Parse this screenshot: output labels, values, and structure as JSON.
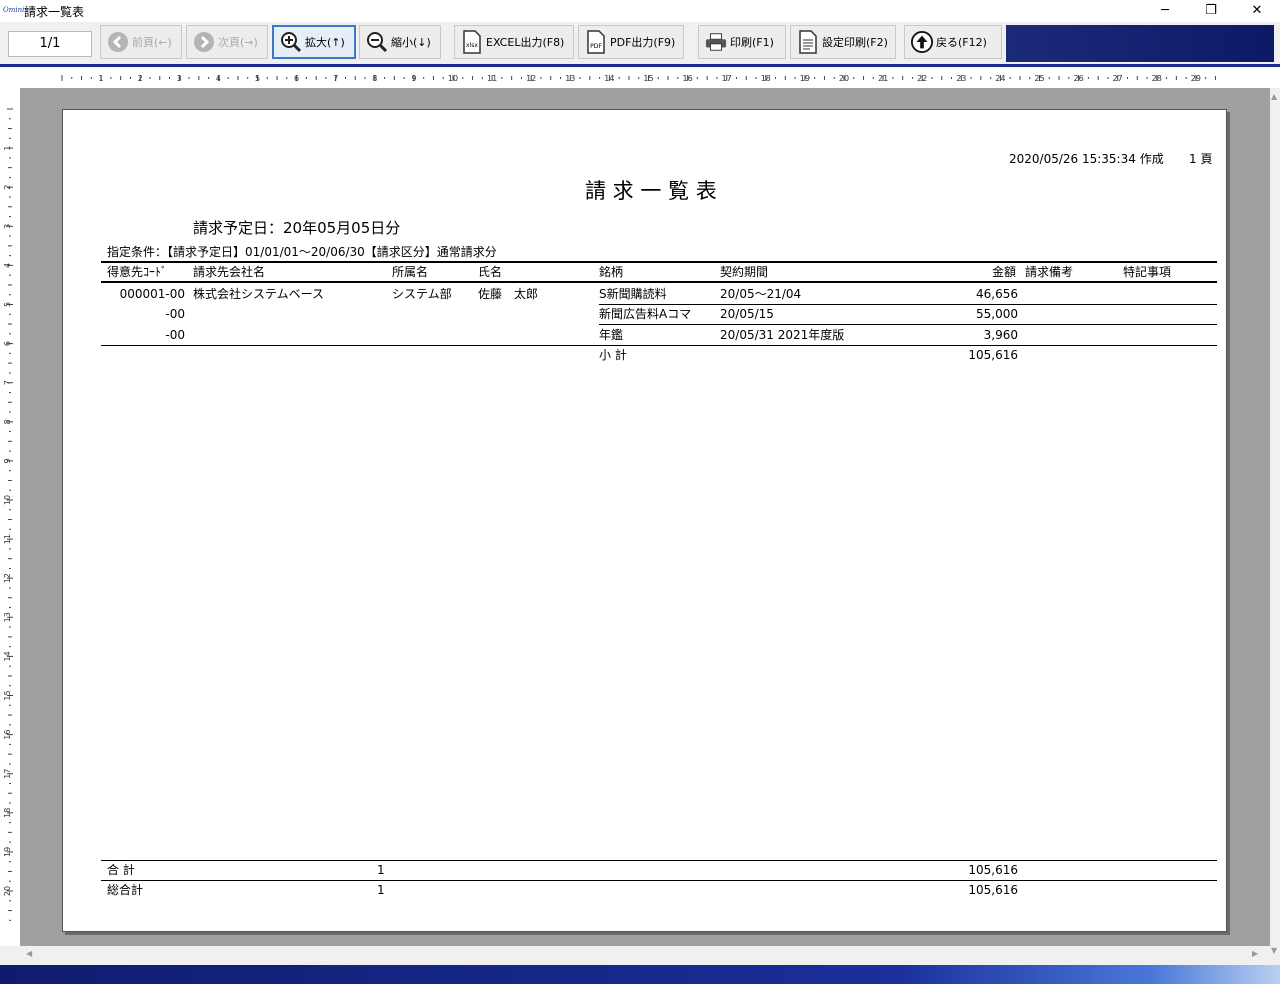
{
  "window": {
    "app_icon_text": "Ominis",
    "title": "請求一覧表",
    "minimize": "─",
    "restore": "❐",
    "close": "✕"
  },
  "toolbar": {
    "page_indicator": "1/1",
    "prev_label": "前頁(←)",
    "next_label": "次頁(→)",
    "zoom_in_label": "拡大(↑)",
    "zoom_out_label": "縮小(↓)",
    "excel_label": "EXCEL出力(F8)",
    "excel_icon_text": "xlsx",
    "pdf_label": "PDF出力(F9)",
    "pdf_icon_text": "PDF",
    "print_label": "印刷(F1)",
    "setting_print_label": "設定印刷(F2)",
    "back_label": "戻る(F12)"
  },
  "ruler": {
    "h_ticks": [
      "1",
      "2",
      "3",
      "4",
      "5",
      "6",
      "7",
      "8",
      "9",
      "10",
      "11",
      "12",
      "13",
      "14",
      "15",
      "16",
      "17",
      "18",
      "19",
      "20",
      "21",
      "22",
      "23",
      "24",
      "25",
      "26",
      "27",
      "28",
      "29"
    ],
    "v_ticks": [
      "1",
      "2",
      "3",
      "4",
      "5",
      "6",
      "7",
      "8",
      "9",
      "10",
      "11",
      "12",
      "13",
      "14",
      "15",
      "16",
      "17",
      "18",
      "19",
      "20"
    ]
  },
  "report": {
    "created": "2020/05/26 15:35:34 作成",
    "page_no": "1 頁",
    "title": "請 求 一 覧 表",
    "scheduled_date": "請求予定日：20年05月05日分",
    "condition": "指定条件：【請求予定日】01/01/01～20/06/30【請求区分】通常請求分",
    "headers": {
      "code": "得意先ｺｰﾄﾞ",
      "company": "請求先会社名",
      "dept": "所属名",
      "name": "氏名",
      "item": "銘柄",
      "period": "契約期間",
      "amount": "金額",
      "remark": "請求備考",
      "note": "特記事項"
    },
    "rows": [
      {
        "code": "000001-00",
        "company": "株式会社システムベース",
        "dept": "システム部",
        "name": "佐藤　太郎",
        "item": "S新聞購読料",
        "period": "20/05～21/04",
        "amount": "46,656"
      },
      {
        "code": "-00",
        "company": "",
        "dept": "",
        "name": "",
        "item": "新聞広告料Aコマ",
        "period": "20/05/15",
        "amount": "55,000"
      },
      {
        "code": "-00",
        "company": "",
        "dept": "",
        "name": "",
        "item": "年鑑",
        "period": "20/05/31 2021年度版",
        "amount": "3,960"
      }
    ],
    "subtotal": {
      "label": "小 計",
      "amount": "105,616"
    },
    "total": {
      "label": "合 計",
      "count": "1",
      "amount": "105,616"
    },
    "grand_total": {
      "label": "総合計",
      "count": "1",
      "amount": "105,616"
    }
  }
}
